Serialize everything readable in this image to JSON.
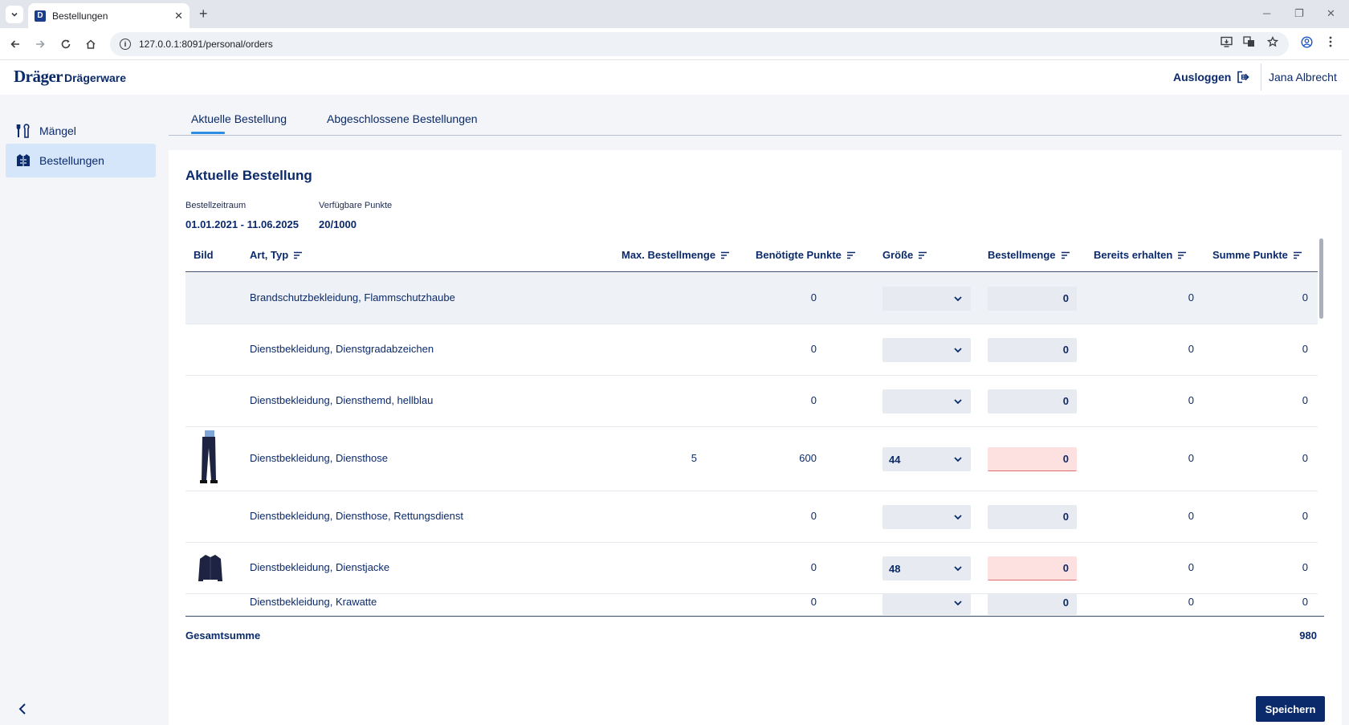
{
  "browser": {
    "tab_title": "Bestellungen",
    "favicon_letter": "D",
    "url": "127.0.0.1:8091/personal/orders",
    "new_tab": "+",
    "close_tab": "✕"
  },
  "header": {
    "logo": "Dräger",
    "app_name": "Drägerware",
    "logout_label": "Ausloggen",
    "user_name": "Jana Albrecht"
  },
  "sidebar": {
    "items": [
      {
        "label": "Mängel",
        "icon": "tools-icon"
      },
      {
        "label": "Bestellungen",
        "icon": "clothing-icon",
        "active": true
      }
    ]
  },
  "tabs": [
    {
      "label": "Aktuelle Bestellung",
      "active": true
    },
    {
      "label": "Abgeschlossene Bestellungen",
      "active": false
    }
  ],
  "order": {
    "title": "Aktuelle Bestellung",
    "period_label": "Bestellzeitraum",
    "period_value": "01.01.2021 - 11.06.2025",
    "points_label": "Verfügbare Punkte",
    "points_value": "20/1000"
  },
  "table": {
    "columns": {
      "image": "Bild",
      "type": "Art, Typ",
      "max_qty": "Max. Bestellmenge",
      "points": "Benötigte Punkte",
      "size": "Größe",
      "qty": "Bestellmenge",
      "received": "Bereits erhalten",
      "sum": "Summe Punkte"
    },
    "rows": [
      {
        "type": "Brandschutzbekleidung, Flammschutzhaube",
        "max_qty": "",
        "points": "0",
        "size": "",
        "qty": "0",
        "received": "0",
        "sum": "0",
        "image": "",
        "error": false
      },
      {
        "type": "Dienstbekleidung, Dienstgradabzeichen",
        "max_qty": "",
        "points": "0",
        "size": "",
        "qty": "0",
        "received": "0",
        "sum": "0",
        "image": "",
        "error": false
      },
      {
        "type": "Dienstbekleidung, Diensthemd, hellblau",
        "max_qty": "",
        "points": "0",
        "size": "",
        "qty": "0",
        "received": "0",
        "sum": "0",
        "image": "",
        "error": false
      },
      {
        "type": "Dienstbekleidung, Diensthose",
        "max_qty": "5",
        "points": "600",
        "size": "44",
        "qty": "0",
        "received": "0",
        "sum": "0",
        "image": "trousers",
        "error": true
      },
      {
        "type": "Dienstbekleidung, Diensthose, Rettungsdienst",
        "max_qty": "",
        "points": "0",
        "size": "",
        "qty": "0",
        "received": "0",
        "sum": "0",
        "image": "",
        "error": false
      },
      {
        "type": "Dienstbekleidung, Dienstjacke",
        "max_qty": "",
        "points": "0",
        "size": "48",
        "qty": "0",
        "received": "0",
        "sum": "0",
        "image": "jacket",
        "error": true
      },
      {
        "type": "Dienstbekleidung, Krawatte",
        "max_qty": "",
        "points": "0",
        "size": "",
        "qty": "0",
        "received": "0",
        "sum": "0",
        "image": "",
        "error": false
      }
    ],
    "total_label": "Gesamtsumme",
    "total_value": "980"
  },
  "actions": {
    "save_label": "Speichern"
  },
  "colors": {
    "brand": "#0b2a6b",
    "accent": "#2b8ee3",
    "error_bg": "#fde0e0",
    "active_nav": "#d5e6fa"
  }
}
